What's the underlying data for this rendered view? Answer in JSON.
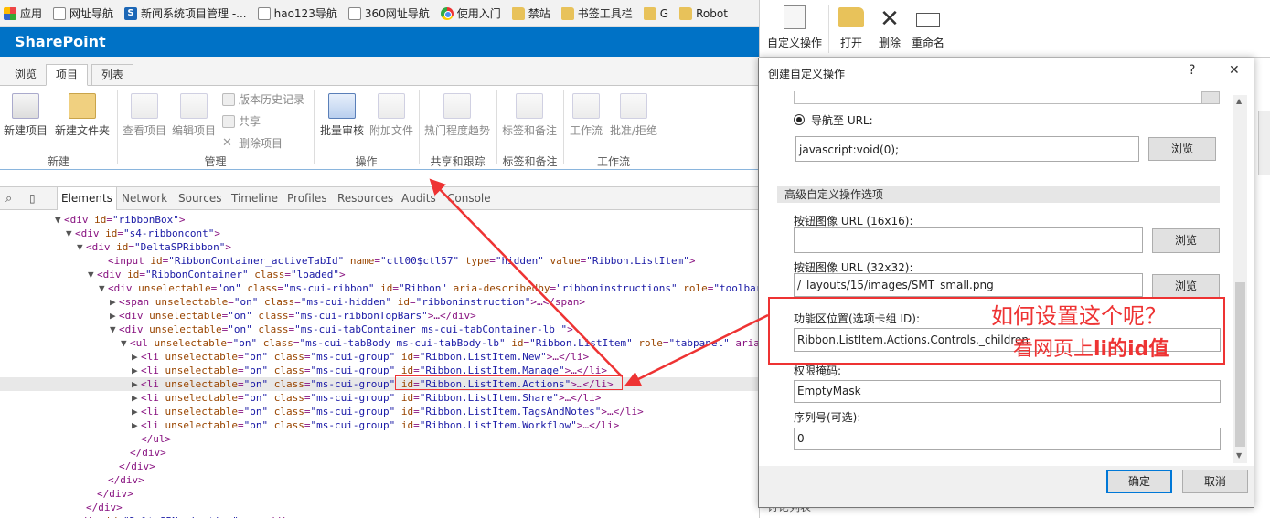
{
  "bookmarks": [
    {
      "label": "应用",
      "icon": "apps-icon"
    },
    {
      "label": "网址导航",
      "icon": "page-icon"
    },
    {
      "label": "新闻系统项目管理 -...",
      "icon": "sharepoint-icon"
    },
    {
      "label": "hao123导航",
      "icon": "page-icon"
    },
    {
      "label": "360网址导航",
      "icon": "page-icon"
    },
    {
      "label": "使用入门",
      "icon": "chrome-icon"
    },
    {
      "label": "禁站",
      "icon": "folder-icon"
    },
    {
      "label": "书签工具栏",
      "icon": "folder-icon"
    },
    {
      "label": "G",
      "icon": "folder-icon"
    },
    {
      "label": "Robot",
      "icon": "folder-icon"
    }
  ],
  "app_title": "SharePoint",
  "tabs": [
    "浏览",
    "项目",
    "列表"
  ],
  "ribbon": {
    "new_item": "新建项目",
    "new_folder": "新建文件夹",
    "view_item": "查看项目",
    "edit_item": "编辑项目",
    "version_history": "版本历史记录",
    "share": "共享",
    "delete_item": "删除项目",
    "bulk_approve": "批量审核",
    "attach_file": "附加文件",
    "popularity": "热门程度趋势",
    "tags_notes": "标签和备注",
    "workflow": "工作流",
    "approve_reject": "批准/拒绝",
    "groups": [
      "新建",
      "管理",
      "操作",
      "共享和跟踪",
      "标签和备注",
      "工作流"
    ]
  },
  "devtools": {
    "tabs": [
      "Elements",
      "Network",
      "Sources",
      "Timeline",
      "Profiles",
      "Resources",
      "Audits",
      "Console"
    ],
    "lines": [
      {
        "indent": 60,
        "tri": "▼",
        "text": "<div id=\"ribbonBox\">"
      },
      {
        "indent": 72,
        "tri": "▼",
        "text": "<div id=\"s4-ribboncont\">"
      },
      {
        "indent": 84,
        "tri": "▼",
        "text": "<div id=\"DeltaSPRibbon\">"
      },
      {
        "indent": 108,
        "tri": "",
        "text": "<input id=\"RibbonContainer_activeTabId\" name=\"ctl00$ctl57\" type=\"hidden\" value=\"Ribbon.ListItem\">"
      },
      {
        "indent": 96,
        "tri": "▼",
        "text": "<div id=\"RibbonContainer\" class=\"loaded\">"
      },
      {
        "indent": 108,
        "tri": "▼",
        "text": "<div unselectable=\"on\" class=\"ms-cui-ribbon\" id=\"Ribbon\" aria-describedby=\"ribboninstructions\" role=\"toolbar\">"
      },
      {
        "indent": 120,
        "tri": "▶",
        "text": "<span unselectable=\"on\" class=\"ms-cui-hidden\" id=\"ribboninstruction\">…</span>"
      },
      {
        "indent": 120,
        "tri": "▶",
        "text": "<div unselectable=\"on\" class=\"ms-cui-ribbonTopBars\">…</div>"
      },
      {
        "indent": 120,
        "tri": "▼",
        "text": "<div unselectable=\"on\" class=\"ms-cui-tabContainer ms-cui-tabContainer-lb \">"
      },
      {
        "indent": 132,
        "tri": "▼",
        "text": "<ul unselectable=\"on\" class=\"ms-cui-tabBody ms-cui-tabBody-lb\" id=\"Ribbon.ListItem\" role=\"tabpanel\" aria-"
      },
      {
        "indent": 144,
        "tri": "▶",
        "text": "<li unselectable=\"on\" class=\"ms-cui-group\" id=\"Ribbon.ListItem.New\">…</li>"
      },
      {
        "indent": 144,
        "tri": "▶",
        "text": "<li unselectable=\"on\" class=\"ms-cui-group\" id=\"Ribbon.ListItem.Manage\">…</li>"
      },
      {
        "indent": 144,
        "tri": "▶",
        "text": "<li unselectable=\"on\" class=\"ms-cui-group\" id=\"Ribbon.ListItem.Actions\">…</li>"
      },
      {
        "indent": 144,
        "tri": "▶",
        "text": "<li unselectable=\"on\" class=\"ms-cui-group\" id=\"Ribbon.ListItem.Share\">…</li>"
      },
      {
        "indent": 144,
        "tri": "▶",
        "text": "<li unselectable=\"on\" class=\"ms-cui-group\" id=\"Ribbon.ListItem.TagsAndNotes\">…</li>"
      },
      {
        "indent": 144,
        "tri": "▶",
        "text": "<li unselectable=\"on\" class=\"ms-cui-group\" id=\"Ribbon.ListItem.Workflow\">…</li>"
      },
      {
        "indent": 144,
        "tri": "",
        "text": "</ul>"
      },
      {
        "indent": 132,
        "tri": "",
        "text": "</div>"
      },
      {
        "indent": 120,
        "tri": "",
        "text": "</div>"
      },
      {
        "indent": 108,
        "tri": "",
        "text": "</div>"
      },
      {
        "indent": 96,
        "tri": "",
        "text": "</div>"
      },
      {
        "indent": 84,
        "tri": "",
        "text": "</div>"
      },
      {
        "indent": 72,
        "tri": "▶",
        "text": "<div id=\"DeltaSPNavigation\"> … </div>"
      }
    ],
    "selected_line": 12
  },
  "right_toolbar": {
    "custom_action": "自定义操作",
    "open": "打开",
    "delete": "删除",
    "rename": "重命名"
  },
  "dialog": {
    "title": "创建自定义操作",
    "help": "?",
    "close": "✕",
    "navigate_url_label": "导航至 URL:",
    "navigate_url_value": "javascript:void(0);",
    "browse": "浏览",
    "advanced_header": "高级自定义操作选项",
    "img16_label": "按钮图像 URL (16x16):",
    "img16_value": "",
    "img32_label": "按钮图像 URL (32x32):",
    "img32_value": "/_layouts/15/images/SMT_small.png",
    "location_label": "功能区位置(选项卡组 ID):",
    "location_value": "Ribbon.ListItem.Actions.Controls._children",
    "rights_label": "权限掩码:",
    "rights_value": "EmptyMask",
    "sequence_label": "序列号(可选):",
    "sequence_value": "0",
    "ok": "确定",
    "cancel": "取消"
  },
  "annotation": {
    "line1": "如何设置这个呢？",
    "line2_prefix": "看网页上",
    "line2_bold": "li的id值"
  },
  "background_fragment": "讨论列表",
  "colors": {
    "sharepoint_blue": "#0072c6",
    "annotation_red": "#e33333"
  }
}
